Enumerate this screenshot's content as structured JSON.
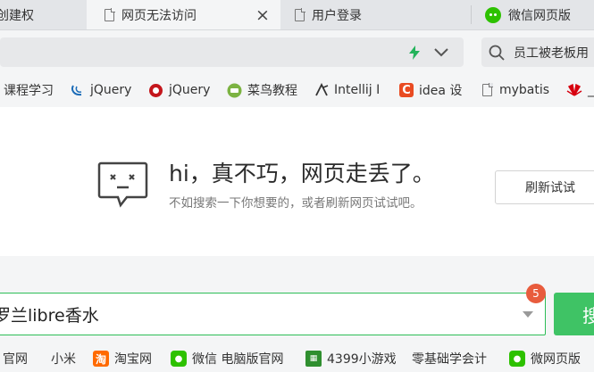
{
  "tabs": [
    {
      "label": "创建权"
    },
    {
      "label": "网页无法访问",
      "close_label": "×"
    },
    {
      "label": "用户登录"
    },
    {
      "label": "微信网页版"
    }
  ],
  "search": {
    "text": "员工被老板用"
  },
  "bookmarks": [
    {
      "label": "课程学习",
      "icon": "bookmark-icon"
    },
    {
      "label": "jQuery",
      "icon": "jquery-icon"
    },
    {
      "label": "jQuery",
      "icon": "jquery-red-icon"
    },
    {
      "label": "菜鸟教程",
      "icon": "runoob-icon"
    },
    {
      "label": "Intellij I",
      "icon": "intellij-icon"
    },
    {
      "label": "idea 设",
      "icon": "c-icon"
    },
    {
      "label": "mybatis",
      "icon": "doc-icon"
    },
    {
      "label": "_",
      "icon": "huawei-icon"
    }
  ],
  "error": {
    "title": "hi，真不巧，网页走丢了。",
    "subtitle": "不如搜索一下你想要的，或者刷新网页试试吧。",
    "refresh_label": "刷新试试"
  },
  "search_bar": {
    "query": "罗兰libre香水",
    "badge": "5",
    "button_label": "搜"
  },
  "quick_links": [
    {
      "label": "官网",
      "icon": ""
    },
    {
      "label": "小米",
      "icon": ""
    },
    {
      "label": "淘宝网",
      "icon": "taobao-icon"
    },
    {
      "label": "微信 电脑版官网",
      "icon": "wechat-icon"
    },
    {
      "label": "4399小游戏",
      "icon": "4399-icon"
    },
    {
      "label": "零基础学会计",
      "icon": ""
    },
    {
      "label": "微网页版",
      "icon": "wechat-icon"
    }
  ],
  "colors": {
    "accent": "#2dbd57",
    "badge": "#e85c3d",
    "wechat": "#2dc100"
  }
}
